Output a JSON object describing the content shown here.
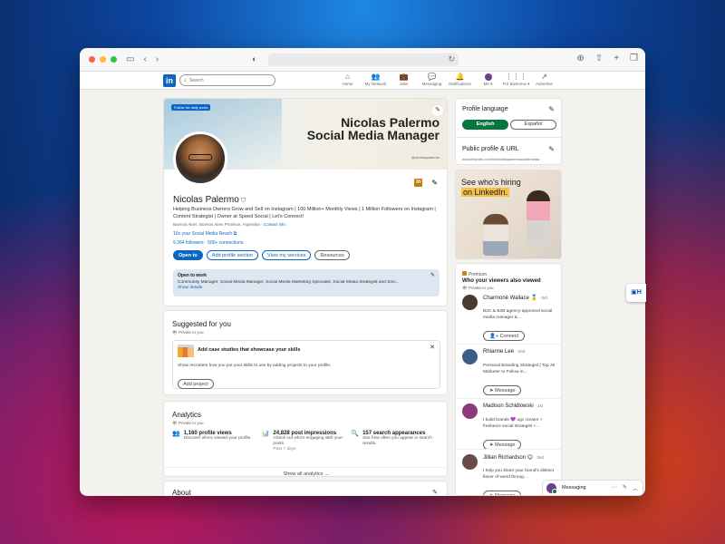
{
  "nav": {
    "search_placeholder": "Search",
    "items": [
      {
        "label": "Home",
        "icon": "⌂"
      },
      {
        "label": "My Network",
        "icon": "👥"
      },
      {
        "label": "Jobs",
        "icon": "💼"
      },
      {
        "label": "Messaging",
        "icon": "💬"
      },
      {
        "label": "Notifications",
        "icon": "🔔"
      },
      {
        "label": "Me ▾",
        "icon": ""
      },
      {
        "label": "For Business ▾",
        "icon": "⋮⋮⋮"
      },
      {
        "label": "Advertise",
        "icon": "↗"
      }
    ]
  },
  "banner": {
    "badge": "Follow for daily posts",
    "title_line1": "Nicolas Palermo",
    "title_line2": "Social Media Manager",
    "small_text": "@nicolaspalermo"
  },
  "profile": {
    "name": "Nicolas Palermo",
    "headline": "Helping Business Owners Grow and Sell on Instagram | 100 Million+ Monthly Views | 1 Million Followers on Instagram | Content Strategist | Owner at Speed Social | Let's Connect!",
    "location": "Buenos Aires, Buenos Aires Province, Argentina ·",
    "contact_info": "Contact info",
    "link": "10x your Social Media Reach",
    "followers": "9,364 followers",
    "connections": "500+ connections",
    "buttons": {
      "open_to": "Open to",
      "add_section": "Add profile section",
      "view_services": "View my services",
      "resources": "Resources"
    },
    "open_to_work": {
      "title": "Open to work",
      "text": "Community Manager, Social Media Manager, Social Media Marketing Specialist, Social Media Strategist and Soci...",
      "link": "Show details"
    }
  },
  "suggested": {
    "title": "Suggested for you",
    "private": "Private to you",
    "card_title": "Add case studies that showcase your skills",
    "card_desc": "Show recruiters how you put your skills to use by adding projects to your profile.",
    "button": "Add project"
  },
  "analytics": {
    "title": "Analytics",
    "private": "Private to you",
    "items": [
      {
        "icon": "👥",
        "value": "1,160 profile views",
        "desc": "Discover who's viewed your profile.",
        "note": ""
      },
      {
        "icon": "📊",
        "value": "24,828 post impressions",
        "desc": "Check out who's engaging with your posts.",
        "note": "Past 7 days"
      },
      {
        "icon": "🔍",
        "value": "157 search appearances",
        "desc": "See how often you appear in search results.",
        "note": ""
      }
    ],
    "show_all": "Show all analytics →"
  },
  "about": {
    "title": "About"
  },
  "right": {
    "profile_language": "Profile language",
    "lang_english": "English",
    "lang_spanish": "Español",
    "public_profile": "Public profile & URL",
    "public_url": "www.linkedin.com/in/nicolaspalermosocialmedia",
    "ad_line1": "See who's hiring",
    "ad_line2": "on LinkedIn.",
    "premium": "Premium",
    "who_viewed": "Who your viewers also viewed",
    "private": "Private to you",
    "viewers": [
      {
        "name": "Charmoné Wallace",
        "badge": "🏅",
        "degree": "· 3rd",
        "desc": "B2C & B2B agency-approved social media manager &...",
        "button": "Connect",
        "btn_icon": "👤+",
        "color": "#4a3a30"
      },
      {
        "name": "Rhianne Lee",
        "badge": "",
        "degree": "· 2nd",
        "desc": "Personal Branding Strategist | Top 25 Marketer to Follow in...",
        "button": "Message",
        "btn_icon": "➤",
        "color": "#3c5f8a"
      },
      {
        "name": "Madison Schidlowski",
        "badge": "",
        "degree": "· 1st",
        "desc": "I build brands 💜 ugc creator + freelance social strategist +...",
        "button": "Message",
        "btn_icon": "➤",
        "color": "#8a3a7a"
      },
      {
        "name": "Jillian Richardson",
        "badge": "😊",
        "degree": "· 2nd",
        "desc": "I help you share your brand's distinct flavor of weird throug...",
        "button": "Message",
        "btn_icon": "➤",
        "color": "#6a4a4a"
      }
    ]
  },
  "messaging": {
    "label": "Messaging"
  },
  "colors": {
    "brand": "#0a66c2",
    "green": "#057642"
  }
}
